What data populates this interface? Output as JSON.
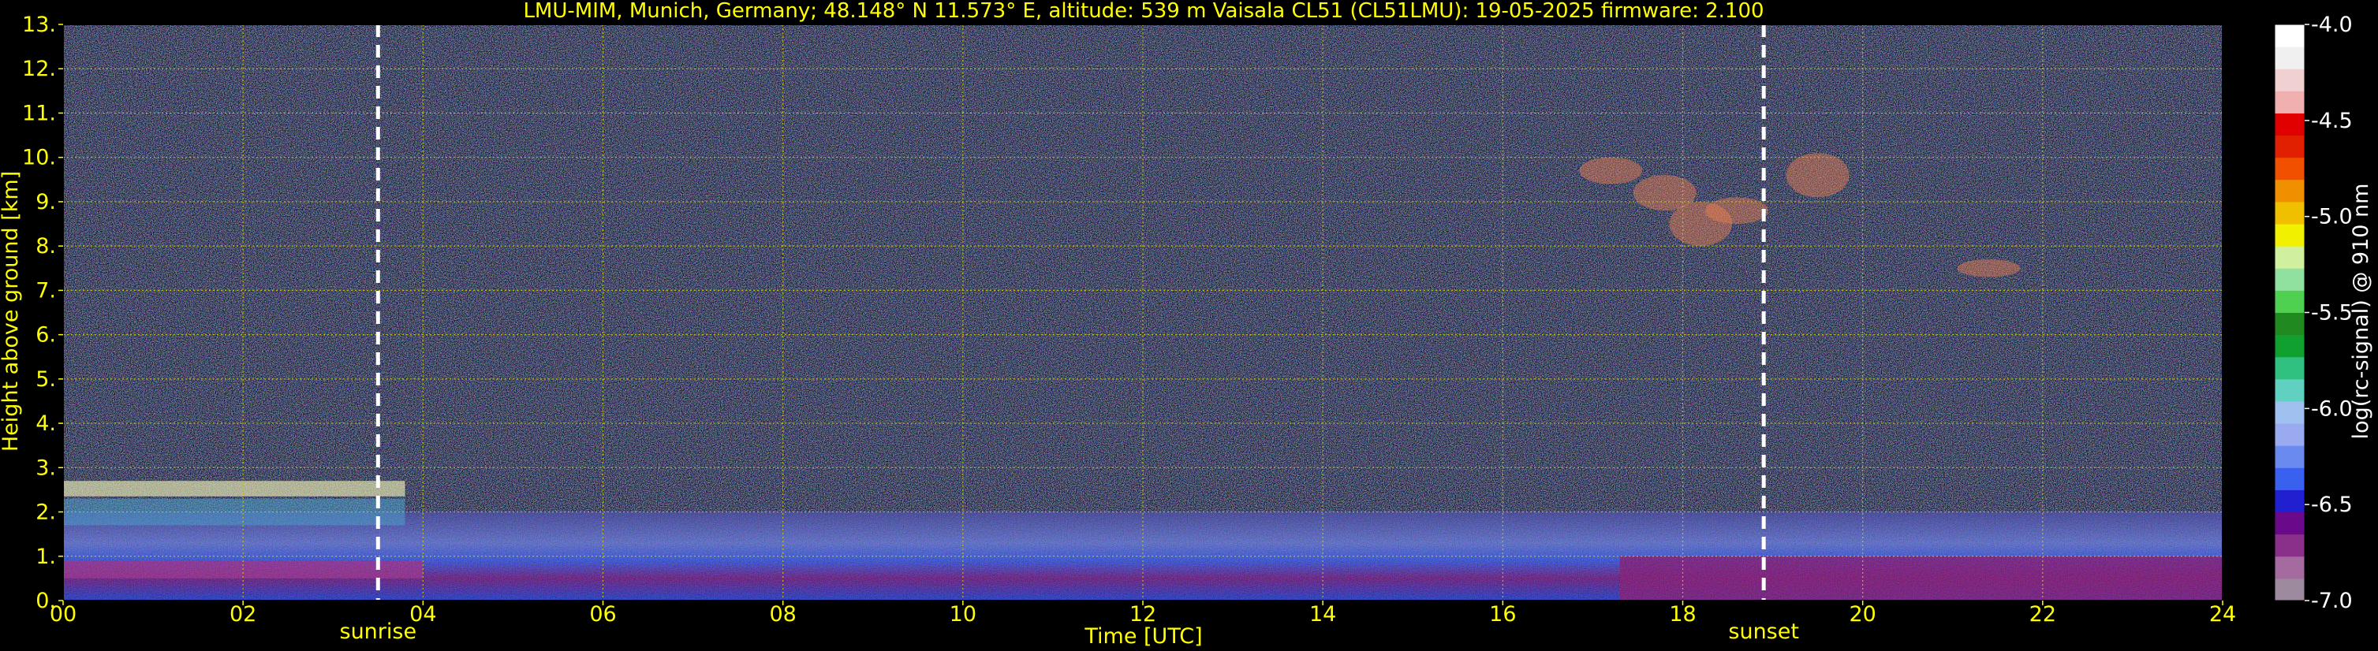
{
  "chart_data": {
    "type": "heatmap",
    "title": "LMU-MIM, Munich, Germany; 48.148° N 11.573° E, altitude: 539 m    Vaisala CL51 (CL51LMU): 19-05-2025    firmware: 2.100",
    "xlabel": "Time [UTC]",
    "ylabel": "Height above ground [km]",
    "xlim": [
      0,
      24
    ],
    "ylim": [
      0,
      13
    ],
    "x_ticks": [
      "00",
      "02",
      "04",
      "06",
      "08",
      "10",
      "12",
      "14",
      "16",
      "18",
      "20",
      "22",
      "24"
    ],
    "y_ticks": [
      "0.",
      "1.",
      "2.",
      "3.",
      "4.",
      "5.",
      "6.",
      "7.",
      "8.",
      "9.",
      "10.",
      "11.",
      "12.",
      "13."
    ],
    "grid": true,
    "markers": [
      {
        "label": "sunrise",
        "x": 3.5
      },
      {
        "label": "sunset",
        "x": 18.9
      }
    ],
    "colorbar": {
      "label": "log(rc-signal) @ 910 nm",
      "range": [
        -7.0,
        -4.0
      ],
      "ticks": [
        "-4.0",
        "-4.5",
        "-5.0",
        "-5.5",
        "-6.0",
        "-6.5",
        "-7.0"
      ],
      "tick_values": [
        -4.0,
        -4.5,
        -5.0,
        -5.5,
        -6.0,
        -6.5,
        -7.0
      ],
      "colors": [
        "#9e8a9e",
        "#a56aa0",
        "#8a2f8a",
        "#6a0a8a",
        "#2020d0",
        "#3a60f0",
        "#6a8af0",
        "#9aaaf0",
        "#a0c0f0",
        "#60d0c0",
        "#30c080",
        "#10a030",
        "#208a20",
        "#50d050",
        "#90e0a0",
        "#d0f0a0",
        "#f0f000",
        "#f0c000",
        "#f09000",
        "#f05000",
        "#e02000",
        "#e00000",
        "#f0b0b0",
        "#f0d0d0",
        "#f0f0f0",
        "#ffffff"
      ]
    },
    "colors": {
      "text": "#ffff00",
      "grid": "#c8c800",
      "marker": "#ffffff",
      "background": "#000000"
    }
  }
}
